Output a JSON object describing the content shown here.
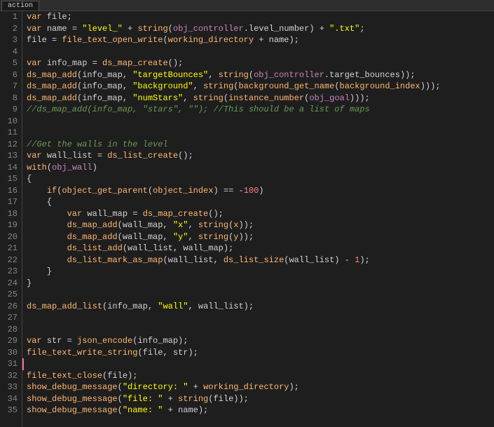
{
  "tab": {
    "label": "action"
  },
  "lines": [
    {
      "n": 1,
      "tokens": [
        {
          "t": "var ",
          "c": "kw"
        },
        {
          "t": "file;",
          "c": "plain"
        }
      ]
    },
    {
      "n": 2,
      "tokens": [
        {
          "t": "var ",
          "c": "kw"
        },
        {
          "t": "name = ",
          "c": "plain"
        },
        {
          "t": "\"level_\"",
          "c": "str"
        },
        {
          "t": " + ",
          "c": "plain"
        },
        {
          "t": "string",
          "c": "fn"
        },
        {
          "t": "(",
          "c": "paren"
        },
        {
          "t": "obj_controller",
          "c": "obj"
        },
        {
          "t": ".level_number) + ",
          "c": "plain"
        },
        {
          "t": "\".txt\"",
          "c": "str"
        },
        {
          "t": ";",
          "c": "plain"
        }
      ]
    },
    {
      "n": 3,
      "tokens": [
        {
          "t": "file = ",
          "c": "plain"
        },
        {
          "t": "file_text_open_write",
          "c": "fn"
        },
        {
          "t": "(",
          "c": "paren"
        },
        {
          "t": "working_directory",
          "c": "fn"
        },
        {
          "t": " + name);",
          "c": "plain"
        }
      ]
    },
    {
      "n": 4,
      "tokens": []
    },
    {
      "n": 5,
      "tokens": [
        {
          "t": "var ",
          "c": "kw"
        },
        {
          "t": "info_map = ",
          "c": "plain"
        },
        {
          "t": "ds_map_create",
          "c": "fn"
        },
        {
          "t": "();",
          "c": "plain"
        }
      ]
    },
    {
      "n": 6,
      "tokens": [
        {
          "t": "ds_map_add",
          "c": "fn"
        },
        {
          "t": "(info_map, ",
          "c": "plain"
        },
        {
          "t": "\"targetBounces\"",
          "c": "str"
        },
        {
          "t": ", ",
          "c": "plain"
        },
        {
          "t": "string",
          "c": "fn"
        },
        {
          "t": "(",
          "c": "paren"
        },
        {
          "t": "obj_controller",
          "c": "obj"
        },
        {
          "t": ".target_bounces));",
          "c": "plain"
        }
      ]
    },
    {
      "n": 7,
      "tokens": [
        {
          "t": "ds_map_add",
          "c": "fn"
        },
        {
          "t": "(info_map, ",
          "c": "plain"
        },
        {
          "t": "\"background\"",
          "c": "str"
        },
        {
          "t": ", ",
          "c": "plain"
        },
        {
          "t": "string",
          "c": "fn"
        },
        {
          "t": "(",
          "c": "paren"
        },
        {
          "t": "background_get_name",
          "c": "fn"
        },
        {
          "t": "(",
          "c": "paren"
        },
        {
          "t": "background_index",
          "c": "fn"
        },
        {
          "t": ")));",
          "c": "plain"
        }
      ]
    },
    {
      "n": 8,
      "tokens": [
        {
          "t": "ds_map_add",
          "c": "fn"
        },
        {
          "t": "(info_map, ",
          "c": "plain"
        },
        {
          "t": "\"numStars\"",
          "c": "str"
        },
        {
          "t": ", ",
          "c": "plain"
        },
        {
          "t": "string",
          "c": "fn"
        },
        {
          "t": "(",
          "c": "paren"
        },
        {
          "t": "instance_number",
          "c": "fn"
        },
        {
          "t": "(",
          "c": "paren"
        },
        {
          "t": "obj_goal",
          "c": "obj"
        },
        {
          "t": ")));",
          "c": "plain"
        }
      ]
    },
    {
      "n": 9,
      "tokens": [
        {
          "t": "//ds_map_add(info_map, \"stars\", \"\"); //This should be a list of maps",
          "c": "cmt"
        }
      ]
    },
    {
      "n": 10,
      "tokens": []
    },
    {
      "n": 11,
      "tokens": []
    },
    {
      "n": 12,
      "tokens": [
        {
          "t": "//Get the walls in the level",
          "c": "cmt"
        }
      ]
    },
    {
      "n": 13,
      "tokens": [
        {
          "t": "var ",
          "c": "kw"
        },
        {
          "t": "wall_list = ",
          "c": "plain"
        },
        {
          "t": "ds_list_create",
          "c": "fn"
        },
        {
          "t": "();",
          "c": "plain"
        }
      ]
    },
    {
      "n": 14,
      "tokens": [
        {
          "t": "with",
          "c": "kw"
        },
        {
          "t": "(",
          "c": "paren"
        },
        {
          "t": "obj_wall",
          "c": "obj"
        },
        {
          "t": ")",
          "c": "paren"
        }
      ]
    },
    {
      "n": 15,
      "tokens": [
        {
          "t": "{",
          "c": "plain"
        }
      ]
    },
    {
      "n": 16,
      "tokens": [
        {
          "t": "    ",
          "c": "plain"
        },
        {
          "t": "if",
          "c": "kw"
        },
        {
          "t": "(",
          "c": "paren"
        },
        {
          "t": "object_get_parent",
          "c": "fn"
        },
        {
          "t": "(",
          "c": "paren"
        },
        {
          "t": "object_index",
          "c": "fn"
        },
        {
          "t": ") == -",
          "c": "plain"
        },
        {
          "t": "100",
          "c": "num"
        },
        {
          "t": ")",
          "c": "plain"
        }
      ]
    },
    {
      "n": 17,
      "tokens": [
        {
          "t": "    {",
          "c": "plain"
        }
      ]
    },
    {
      "n": 18,
      "tokens": [
        {
          "t": "        ",
          "c": "plain"
        },
        {
          "t": "var ",
          "c": "kw"
        },
        {
          "t": "wall_map = ",
          "c": "plain"
        },
        {
          "t": "ds_map_create",
          "c": "fn"
        },
        {
          "t": "();",
          "c": "plain"
        }
      ]
    },
    {
      "n": 19,
      "tokens": [
        {
          "t": "        ",
          "c": "plain"
        },
        {
          "t": "ds_map_add",
          "c": "fn"
        },
        {
          "t": "(wall_map, ",
          "c": "plain"
        },
        {
          "t": "\"x\"",
          "c": "str"
        },
        {
          "t": ", ",
          "c": "plain"
        },
        {
          "t": "string",
          "c": "fn"
        },
        {
          "t": "(",
          "c": "paren"
        },
        {
          "t": "x",
          "c": "fn"
        },
        {
          "t": "));",
          "c": "plain"
        }
      ]
    },
    {
      "n": 20,
      "tokens": [
        {
          "t": "        ",
          "c": "plain"
        },
        {
          "t": "ds_map_add",
          "c": "fn"
        },
        {
          "t": "(wall_map, ",
          "c": "plain"
        },
        {
          "t": "\"y\"",
          "c": "str"
        },
        {
          "t": ", ",
          "c": "plain"
        },
        {
          "t": "string",
          "c": "fn"
        },
        {
          "t": "(",
          "c": "paren"
        },
        {
          "t": "y",
          "c": "fn"
        },
        {
          "t": "));",
          "c": "plain"
        }
      ]
    },
    {
      "n": 21,
      "tokens": [
        {
          "t": "        ",
          "c": "plain"
        },
        {
          "t": "ds_list_add",
          "c": "fn"
        },
        {
          "t": "(wall_list, wall_map);",
          "c": "plain"
        }
      ]
    },
    {
      "n": 22,
      "tokens": [
        {
          "t": "        ",
          "c": "plain"
        },
        {
          "t": "ds_list_mark_as_map",
          "c": "fn"
        },
        {
          "t": "(wall_list, ",
          "c": "plain"
        },
        {
          "t": "ds_list_size",
          "c": "fn"
        },
        {
          "t": "(wall_list) - ",
          "c": "plain"
        },
        {
          "t": "1",
          "c": "num"
        },
        {
          "t": ");",
          "c": "plain"
        }
      ]
    },
    {
      "n": 23,
      "tokens": [
        {
          "t": "    }",
          "c": "plain"
        }
      ]
    },
    {
      "n": 24,
      "tokens": [
        {
          "t": "}",
          "c": "plain"
        }
      ]
    },
    {
      "n": 25,
      "tokens": []
    },
    {
      "n": 26,
      "tokens": [
        {
          "t": "ds_map_add_list",
          "c": "fn"
        },
        {
          "t": "(info_map, ",
          "c": "plain"
        },
        {
          "t": "\"wall\"",
          "c": "str"
        },
        {
          "t": ", wall_list);",
          "c": "plain"
        }
      ]
    },
    {
      "n": 27,
      "tokens": []
    },
    {
      "n": 28,
      "tokens": []
    },
    {
      "n": 29,
      "tokens": [
        {
          "t": "var ",
          "c": "kw"
        },
        {
          "t": "str = ",
          "c": "plain"
        },
        {
          "t": "json_encode",
          "c": "fn"
        },
        {
          "t": "(info_map);",
          "c": "plain"
        }
      ]
    },
    {
      "n": 30,
      "tokens": [
        {
          "t": "file_text_write_string",
          "c": "fn"
        },
        {
          "t": "(file, str);",
          "c": "plain"
        }
      ]
    },
    {
      "n": 31,
      "tokens": [],
      "cursor": true
    },
    {
      "n": 32,
      "tokens": [
        {
          "t": "file_text_close",
          "c": "fn"
        },
        {
          "t": "(file);",
          "c": "plain"
        }
      ]
    },
    {
      "n": 33,
      "tokens": [
        {
          "t": "show_debug_message",
          "c": "fn"
        },
        {
          "t": "(",
          "c": "paren"
        },
        {
          "t": "\"directory: \"",
          "c": "str"
        },
        {
          "t": " + ",
          "c": "plain"
        },
        {
          "t": "working_directory",
          "c": "fn"
        },
        {
          "t": ");",
          "c": "plain"
        }
      ]
    },
    {
      "n": 34,
      "tokens": [
        {
          "t": "show_debug_message",
          "c": "fn"
        },
        {
          "t": "(",
          "c": "paren"
        },
        {
          "t": "\"file: \"",
          "c": "str"
        },
        {
          "t": " + ",
          "c": "plain"
        },
        {
          "t": "string",
          "c": "fn"
        },
        {
          "t": "(file));",
          "c": "plain"
        }
      ]
    },
    {
      "n": 35,
      "tokens": [
        {
          "t": "show_debug_message",
          "c": "fn"
        },
        {
          "t": "(",
          "c": "paren"
        },
        {
          "t": "\"name: \"",
          "c": "str"
        },
        {
          "t": " + name);",
          "c": "plain"
        }
      ]
    }
  ]
}
